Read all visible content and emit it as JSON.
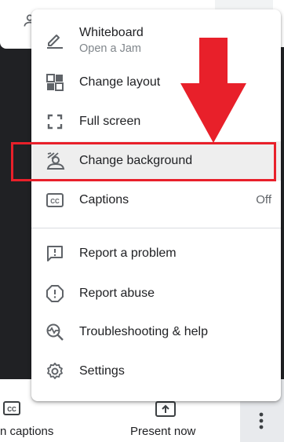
{
  "menu": {
    "items": [
      {
        "label": "Whiteboard",
        "sublabel": "Open a Jam",
        "icon": "pen-icon"
      },
      {
        "label": "Change layout",
        "icon": "layout-icon"
      },
      {
        "label": "Full screen",
        "icon": "fullscreen-icon"
      },
      {
        "label": "Change background",
        "icon": "background-icon",
        "highlighted": true
      },
      {
        "label": "Captions",
        "trailing": "Off",
        "icon": "cc-icon"
      },
      {
        "label": "Report a problem",
        "icon": "feedback-icon"
      },
      {
        "label": "Report abuse",
        "icon": "report-icon"
      },
      {
        "label": "Troubleshooting & help",
        "icon": "troubleshoot-icon"
      },
      {
        "label": "Settings",
        "icon": "gear-icon"
      }
    ]
  },
  "bottom_bar": {
    "captions_label": "n captions",
    "present_label": "Present now"
  },
  "annotation": {
    "arrow_color": "#e8202a",
    "box_color": "#e8202a"
  }
}
